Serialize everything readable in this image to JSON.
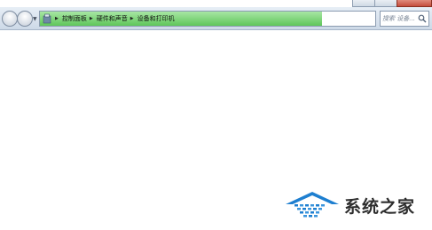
{
  "address_bar": {
    "breadcrumbs": [
      "控制面板",
      "硬件和声音",
      "设备和打印机"
    ],
    "loading_progress_percent": 84
  },
  "search": {
    "placeholder": "搜索 设备..."
  },
  "watermark": {
    "text": "系统之家"
  },
  "colors": {
    "progress_green": "#5fc65a",
    "stop_red": "#c52626",
    "logo_blue": "#1e7fd0"
  },
  "icons": [
    "back-icon",
    "forward-icon",
    "folder-icon",
    "chevron-right-icon",
    "dropdown-icon",
    "stop-icon",
    "search-icon"
  ]
}
